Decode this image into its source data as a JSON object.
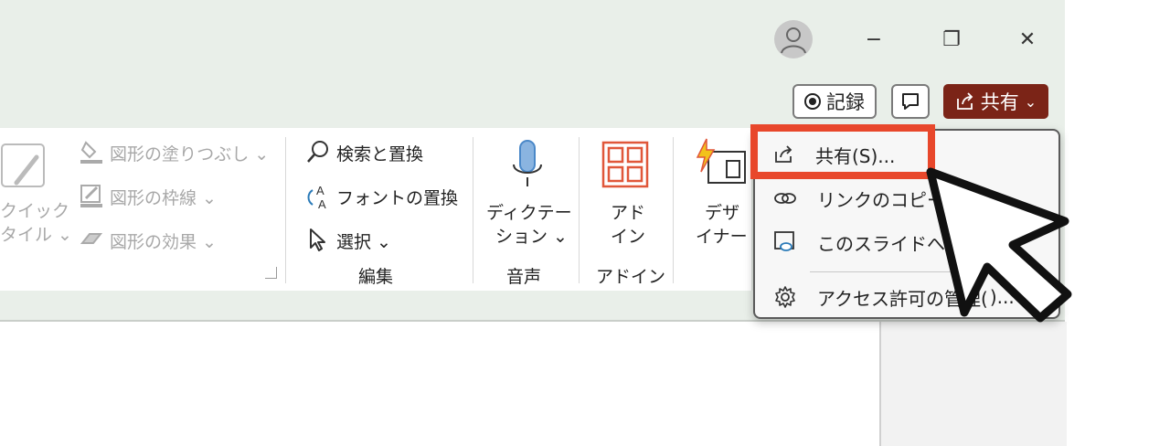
{
  "titlebar": {
    "minimize": "−",
    "restore": "❐",
    "close": "✕"
  },
  "header_buttons": {
    "record_label": "記録",
    "share_label": "共有",
    "share_chevron": "⌄"
  },
  "ribbon": {
    "quick_style_label_1": "クイック",
    "quick_style_label_2": "タイル ⌄",
    "shape_fill": "図形の塗りつぶし ⌄",
    "shape_outline": "図形の枠線 ⌄",
    "shape_effects": "図形の効果 ⌄",
    "find_replace": "検索と置換",
    "font_replace": "フォントの置換",
    "select": "選択 ⌄",
    "edit_group": "編集",
    "dictate_1": "ディクテー",
    "dictate_2": "ション ⌄",
    "voice_group": "音声",
    "addin_1": "アド",
    "addin_2": "イン",
    "addin_group": "アドイン",
    "designer_1": "デザ",
    "designer_2": "イナー"
  },
  "share_menu": {
    "items": [
      {
        "label": "共有(S)...",
        "icon": "share-icon"
      },
      {
        "label": "リンクのコピー(C",
        "icon": "link-icon"
      },
      {
        "label": "このスライドへのリ",
        "icon": "slide-link-icon"
      },
      {
        "label": "アクセス許可の管理(",
        "icon": "gear-icon",
        "suffix": ")..."
      }
    ]
  },
  "colors": {
    "accent": "#7b2417",
    "highlight": "#e8472b",
    "background": "#e9efe9"
  }
}
